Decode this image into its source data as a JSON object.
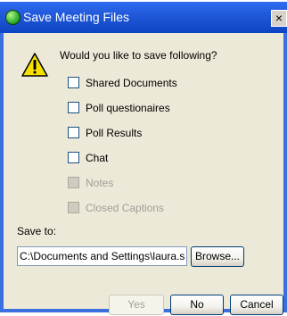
{
  "window": {
    "title": "Save Meeting Files",
    "close_label": "×"
  },
  "prompt": "Would you like to save following?",
  "options": [
    {
      "label": "Shared Documents",
      "checked": false,
      "enabled": true
    },
    {
      "label": "Poll questionaires",
      "checked": false,
      "enabled": true
    },
    {
      "label": "Poll Results",
      "checked": false,
      "enabled": true
    },
    {
      "label": "Chat",
      "checked": false,
      "enabled": true
    },
    {
      "label": "Notes",
      "checked": false,
      "enabled": false
    },
    {
      "label": "Closed Captions",
      "checked": false,
      "enabled": false
    }
  ],
  "save_to": {
    "label": "Save to:",
    "path": "C:\\Documents and Settings\\laura.s",
    "browse_label": "Browse..."
  },
  "buttons": {
    "yes": "Yes",
    "no": "No",
    "cancel": "Cancel"
  },
  "icons": {
    "title": "meeting-globe-icon",
    "warning": "warning-icon"
  },
  "colors": {
    "titlebar": "#1f58d8",
    "client_background": "#ece9d8",
    "warning_fill": "#f7e000",
    "disabled_text": "#a19f97"
  }
}
